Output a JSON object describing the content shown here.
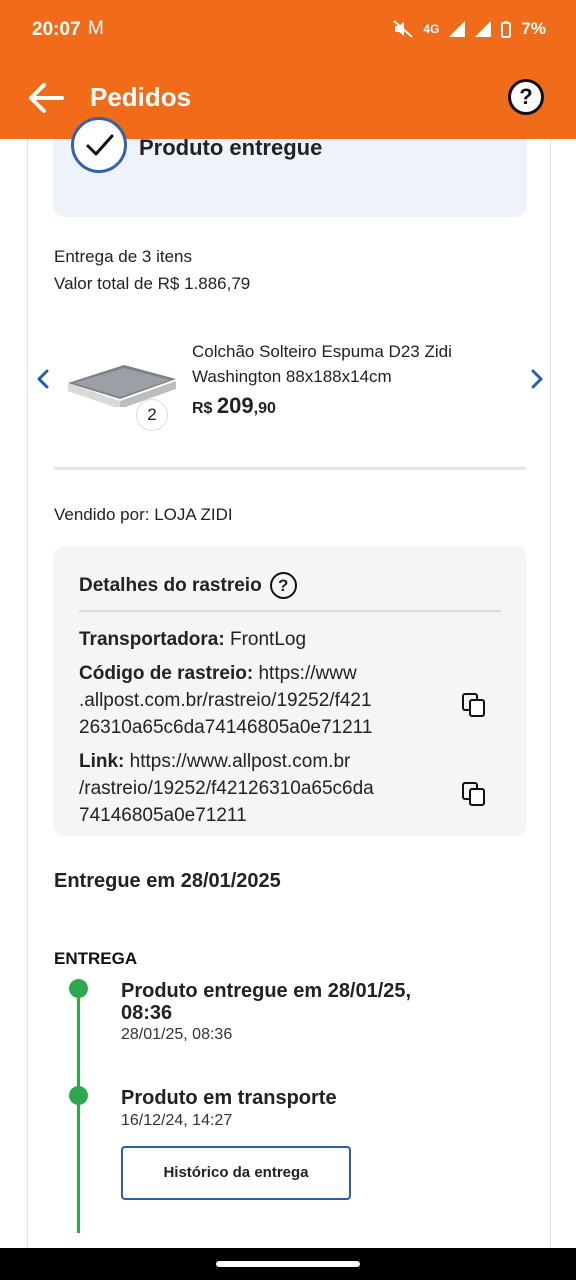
{
  "status_bar": {
    "time": "20:07",
    "mail_glyph": "M",
    "network": "4G",
    "battery": "7%"
  },
  "app_bar": {
    "title": "Pedidos",
    "help_glyph": "?"
  },
  "order": {
    "status_text": "Produto entregue",
    "items_summary": "Entrega de 3 itens",
    "total_summary": "Valor total de R$ 1.886,79",
    "product": {
      "name": "Colchão Solteiro Espuma D23 Zidi Washington 88x188x14cm",
      "quantity": "2",
      "price_currency": "R$",
      "price_int": "209",
      "price_dec": ",90"
    },
    "seller": "Vendido por: LOJA ZIDI"
  },
  "tracking": {
    "title": "Detalhes do rastreio",
    "help_glyph": "?",
    "carrier_label": "Transportadora:",
    "carrier_value": "FrontLog",
    "code_label": "Código de rastreio:",
    "code_line1": "https://www",
    "code_line2": ".allpost.com.br/rastreio/19252/f421",
    "code_line3": "26310a65c6da74146805a0e71211",
    "link_label": "Link:",
    "link_line1": "https://www.allpost.com.br",
    "link_line2": "/rastreio/19252/f42126310a65c6da",
    "link_line3": "74146805a0e71211"
  },
  "delivery": {
    "delivered_on": "Entregue em 28/01/2025",
    "stage_label": "ENTREGA",
    "events": [
      {
        "title_line1": "Produto entregue em 28/01/25,",
        "title_line2": "08:36",
        "time": "28/01/25, 08:36"
      },
      {
        "title_line1": "Produto em transporte",
        "title_line2": "",
        "time": "16/12/24, 14:27"
      }
    ],
    "history_button": "Histórico da entrega"
  },
  "colors": {
    "brand_orange": "#f06b1a",
    "accent_blue": "#2f5ea8",
    "timeline_green": "#2ea84c"
  },
  "icons": [
    "back-arrow-icon",
    "help-icon",
    "check-icon",
    "chevron-left-icon",
    "chevron-right-icon",
    "copy-icon"
  ]
}
